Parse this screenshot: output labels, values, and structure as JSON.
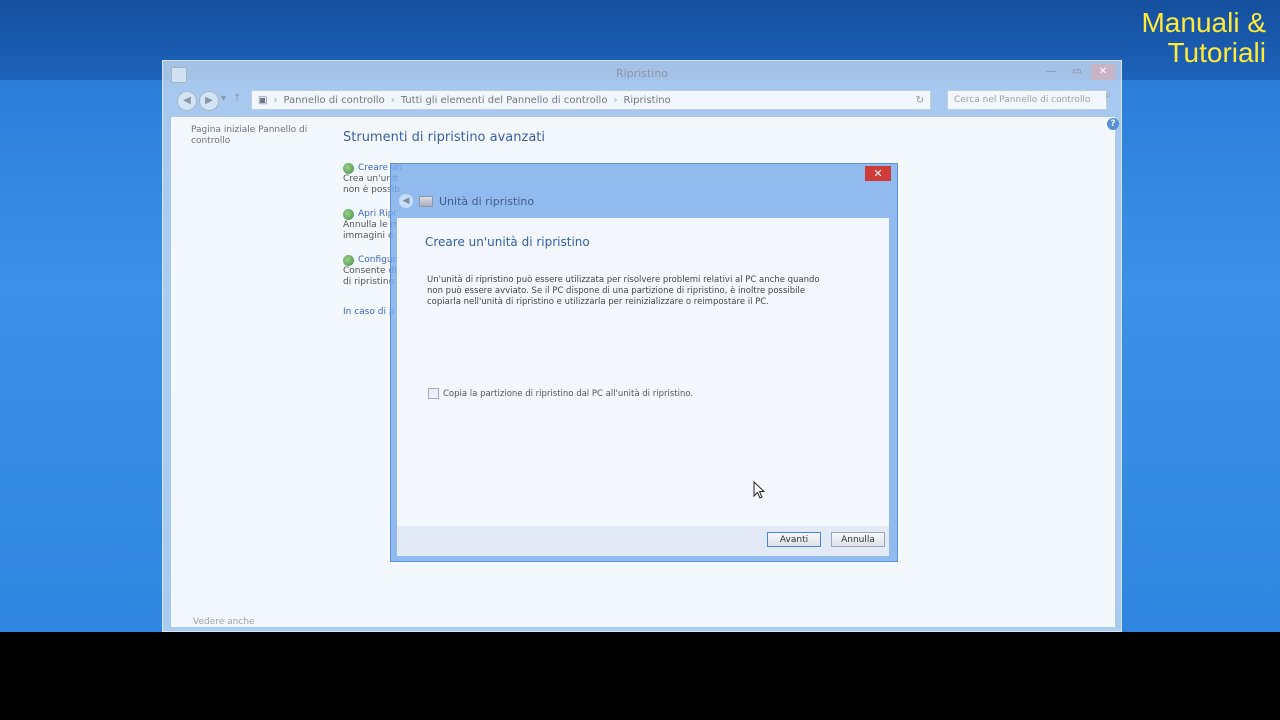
{
  "watermark": {
    "line1": "Manuali &",
    "line2": "Tutoriali",
    "color": "#ffea3a"
  },
  "control_panel": {
    "title": "Ripristino",
    "address": {
      "crumb1": "Pannello di controllo",
      "crumb2": "Tutti gli elementi del Pannello di controllo",
      "crumb3": "Ripristino"
    },
    "search_placeholder": "Cerca nel Pannello di controllo",
    "left_link": "Pagina iniziale Pannello di controllo",
    "see_also": "Vedere anche",
    "heading": "Strumenti di ripristino avanzati",
    "tools": [
      {
        "title": "Creare un",
        "desc1": "Crea un'unit",
        "desc2": "non è possib"
      },
      {
        "title": "Apri Ripr",
        "desc1": "Annulla le m",
        "desc2": "immagini e"
      },
      {
        "title": "Configura",
        "desc1": "Consente di",
        "desc2": "di ripristino."
      }
    ],
    "link_bottom": "In caso di p"
  },
  "dialog": {
    "window_title": "Unità di ripristino",
    "content_title": "Creare un'unità di ripristino",
    "paragraph": "Un'unità di ripristino può essere utilizzata per risolvere problemi relativi al PC anche quando non può essere avviato. Se il PC dispone di una partizione di ripristino, è inoltre possibile copiarla nell'unità di ripristino e utilizzarla per reinizializzare o reimpostare il PC.",
    "checkbox_label": "Copia la partizione di ripristino dal PC all'unità di ripristino.",
    "checkbox_checked": false,
    "next_button": "Avanti",
    "cancel_button": "Annulla",
    "close_glyph": "✕"
  }
}
